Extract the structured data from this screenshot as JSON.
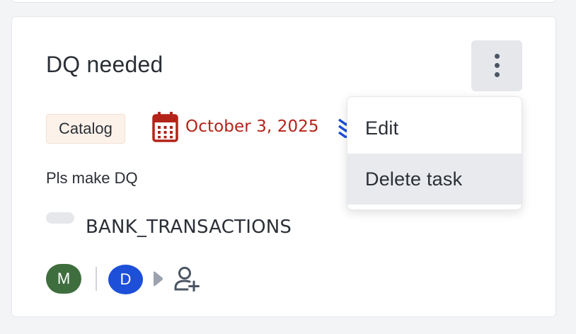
{
  "task": {
    "title": "DQ needed",
    "tag": "Catalog",
    "due_date": "October 3, 2025",
    "description": "Pls make DQ",
    "dataset": "BANK_TRANSACTIONS",
    "assignees": [
      {
        "initial": "M",
        "color": "#3f6e3e"
      },
      {
        "initial": "D",
        "color": "#1d4fd8"
      }
    ]
  },
  "menu": {
    "items": [
      {
        "label": "Edit"
      },
      {
        "label": "Delete task"
      }
    ]
  },
  "icons": {
    "more": "kebab-vertical-icon",
    "calendar": "calendar-icon",
    "priority": "priority-chevrons-icon",
    "dataset": "dataset-pill-icon",
    "arrow": "caret-right-icon",
    "add_user": "user-plus-icon"
  },
  "colors": {
    "due_date": "#b42318",
    "priority": "#1d4fd8",
    "tag_bg": "#fdf2ea",
    "menu_hover": "#e8eaed"
  }
}
